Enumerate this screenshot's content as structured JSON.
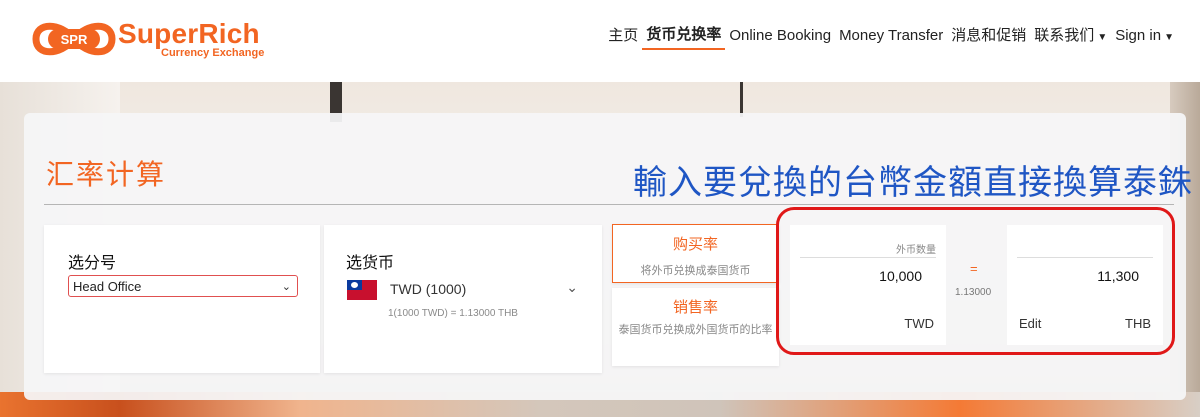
{
  "brand": {
    "logo_text": "SPR",
    "name": "SuperRich",
    "tagline": "Currency Exchange"
  },
  "nav": [
    {
      "label": "主页",
      "active": false
    },
    {
      "label": "货币兑换率",
      "active": true
    },
    {
      "label": "Online Booking",
      "active": false
    },
    {
      "label": "Money Transfer",
      "active": false
    },
    {
      "label": "消息和促销",
      "active": false
    },
    {
      "label": "联系我们",
      "active": false,
      "dropdown": true
    },
    {
      "label": "Sign in",
      "active": false,
      "dropdown": true
    }
  ],
  "calculator": {
    "title": "汇率计算",
    "annotation": "輸入要兌換的台幣金額直接換算泰銖",
    "branch": {
      "label": "选分号",
      "selected": "Head Office"
    },
    "currency": {
      "label": "选货币",
      "selected": "TWD (1000)",
      "rate_note": "1(1000 TWD) = 1.13000 THB",
      "flag_icon": "taiwan-flag-icon"
    },
    "buy_rate": {
      "title": "购买率",
      "subtitle": "将外币兑换成泰国货币"
    },
    "sell_rate": {
      "title": "销售率",
      "subtitle": "泰国货币兑换成外国货币的比率"
    },
    "foreign_amount": {
      "caption": "外币数量",
      "value": "10,000",
      "currency": "TWD"
    },
    "equals_sign": "=",
    "rate_value": "1.13000",
    "thb_amount": {
      "value": "11,300",
      "currency": "THB",
      "edit_label": "Edit"
    }
  },
  "colors": {
    "brand_orange": "#f26522",
    "annotation_blue": "#1f56c4",
    "highlight_red": "#e01818"
  }
}
